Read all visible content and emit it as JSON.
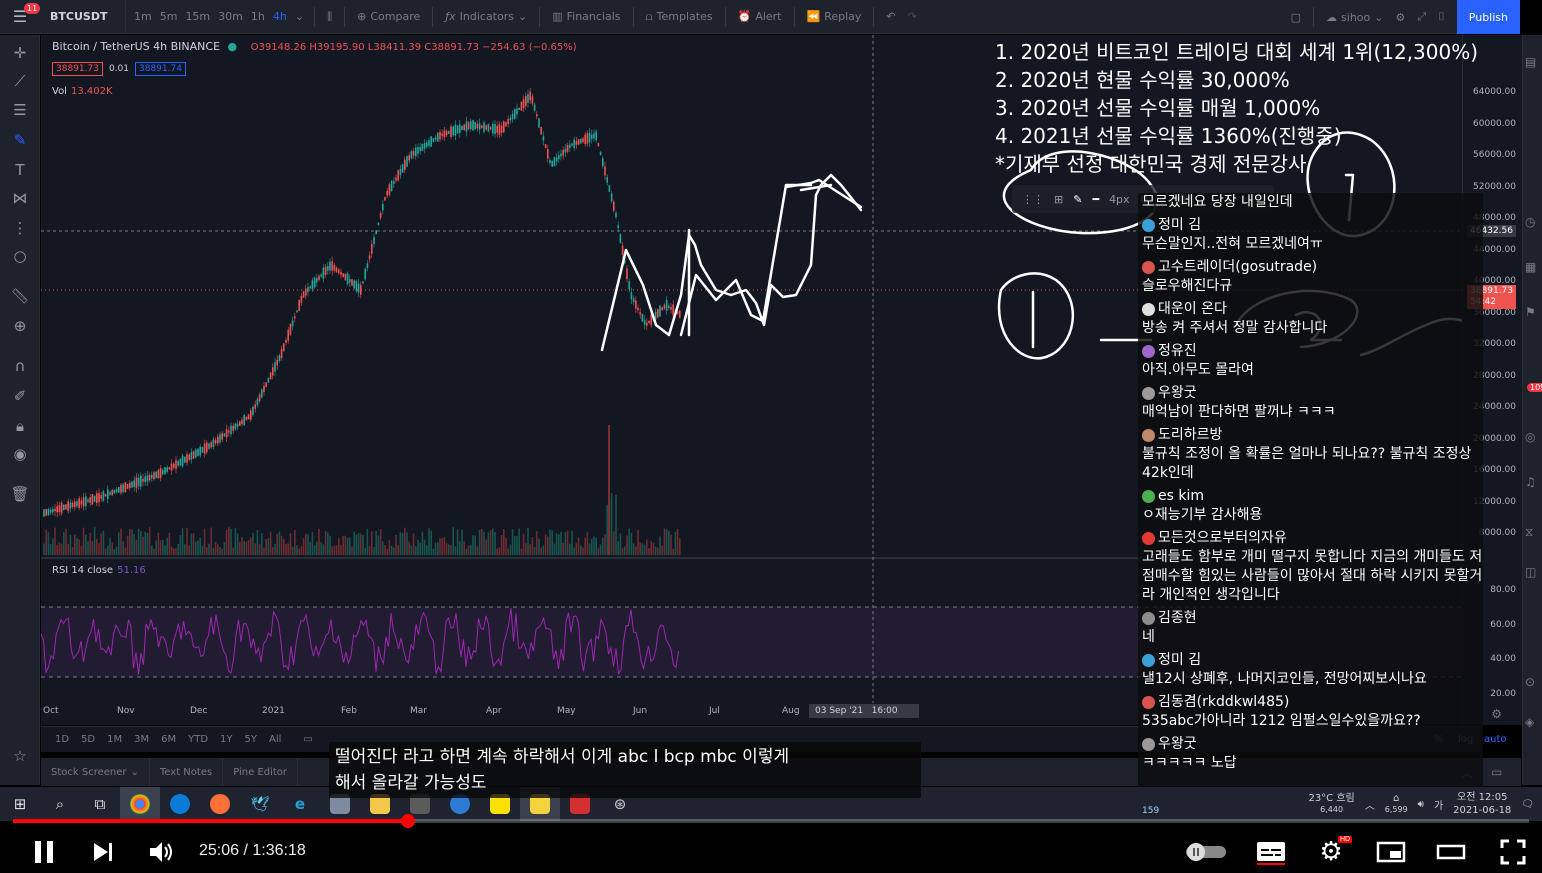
{
  "tv_toolbar": {
    "menu_badge": "11",
    "symbol": "BTCUSDT",
    "intervals": [
      "1m",
      "5m",
      "15m",
      "30m",
      "1h",
      "4h"
    ],
    "active_interval": "4h",
    "compare_label": "Compare",
    "indicators_label": "Indicators",
    "financials_label": "Financials",
    "templates_label": "Templates",
    "alert_label": "Alert",
    "replay_label": "Replay",
    "user_label": "sihoo",
    "publish_label": "Publish"
  },
  "chart_legend": {
    "title": "Bitcoin / TetherUS  4h  BINANCE",
    "ohlc": "O39148.26 H39195.90 L38411.39 C38891.73 −254.63 (−0.65%)",
    "bid": "38891.73",
    "spread": "0.01",
    "ask": "38891.74",
    "vol_label": "Vol",
    "vol_value": "13.402K",
    "rsi_label": "RSI 14 close",
    "rsi_value": "51.16"
  },
  "price_axis": {
    "ticks": [
      "64000.00",
      "60000.00",
      "56000.00",
      "52000.00",
      "48000.00",
      "44000.00",
      "40000.00",
      "36000.00",
      "32000.00",
      "28000.00",
      "24000.00",
      "20000.00",
      "16000.00",
      "12000.00",
      "8000.00"
    ],
    "crosshair_price": "46432.56",
    "last_price": "38891.73",
    "countdown": "54:42",
    "rsi_ticks": [
      "80.00",
      "60.00",
      "40.00",
      "20.00"
    ]
  },
  "time_axis": {
    "labels": [
      "Oct",
      "Nov",
      "Dec",
      "2021",
      "Feb",
      "Mar",
      "Apr",
      "May",
      "Jun",
      "Jul",
      "Aug"
    ],
    "crosshair_date": "03 Sep '21",
    "crosshair_time": "16:00"
  },
  "timeframes": [
    "1D",
    "5D",
    "1M",
    "3M",
    "6M",
    "YTD",
    "1Y",
    "5Y",
    "All"
  ],
  "scale_options": {
    "percent": "%",
    "log": "log",
    "auto": "auto"
  },
  "bottom_tabs": [
    "Stock Screener",
    "Text Notes",
    "Pine Editor"
  ],
  "overlay_lines": [
    "1. 2020년 비트코인 트레이딩 대회 세계 1위(12,300%)",
    "2. 2020년 현물 수익률 30,000%",
    "3. 2020년 선물 수익률 매월 1,000%",
    "4. 2021년 선물 수익률 1360%(진행중)",
    "*기재부 선정 대한민국 경제 전문강사"
  ],
  "float_toolbar": {
    "width_label": "4px"
  },
  "chat": {
    "viewer_count": "159",
    "messages": [
      {
        "author": "",
        "text": "모르겠네요 당장 내일인데",
        "color": "#000000"
      },
      {
        "author": "정미 김",
        "text": "무슨말인지..전혀 모르겠네여ㅠ",
        "color": "#3aa0d8"
      },
      {
        "author": "고수트레이더(gosutrade)",
        "text": "슬로우해진다규",
        "color": "#d9534f"
      },
      {
        "author": "대운이 온다",
        "text": "방송 켜 주셔서 정말 감사합니다",
        "color": "#e0e0e0"
      },
      {
        "author": "정유진",
        "text": "아직.아무도 몰라여",
        "color": "#a066cc"
      },
      {
        "author": "우왕굿",
        "text": "매억남이 판다하면 팔꺼냐 ㅋㅋㅋ",
        "color": "#9a9a9a"
      },
      {
        "author": "도리하르방",
        "text": "불규칙 조정이 올 확률은 얼마나 되나요?? 불규칙 조정상 42k인데",
        "color": "#c08a6a"
      },
      {
        "author": "es kim",
        "text": "ㅇ재능기부 감사해용",
        "color": "#4caf50"
      },
      {
        "author": "모든것으로부터의자유",
        "text": "고래들도 함부로 개미 떨구지 못합니다 지금의 개미들도 저점매수할 힘있는 사람들이 많아서 절대 하락 시키지 못할거 라 개인적인 생각입니다",
        "color": "#e53935"
      },
      {
        "author": "김종현",
        "text": "네",
        "color": "#8d8d8d"
      },
      {
        "author": "정미 김",
        "text": "낼12시 상폐후, 나머지코인들, 전망어찌보시나요",
        "color": "#3aa0d8"
      },
      {
        "author": "김동겸(rkddkwl485)",
        "text": "535abc가아니라 1212 임펄스일수있을까요??",
        "color": "#d9534f"
      },
      {
        "author": "우왕굿",
        "text": "ㅋㅋㅋㅋㅋ 노답",
        "color": "#9a9a9a"
      }
    ]
  },
  "taskbar": {
    "weather": "23°C 흐림",
    "badge_left": "6,440",
    "badge_right": "6,599",
    "time": "오전 12:05",
    "date": "2021-06-18"
  },
  "subtitle": {
    "line1": "떨어진다 라고 하면 계속 하락해서 이게 abc l bcp mbc 이렇게",
    "line2": "해서 올라갈 가능성도"
  },
  "player": {
    "current_time": "25:06",
    "duration": "1:36:18",
    "progress": 0.2606,
    "settings_badge": "HD"
  }
}
